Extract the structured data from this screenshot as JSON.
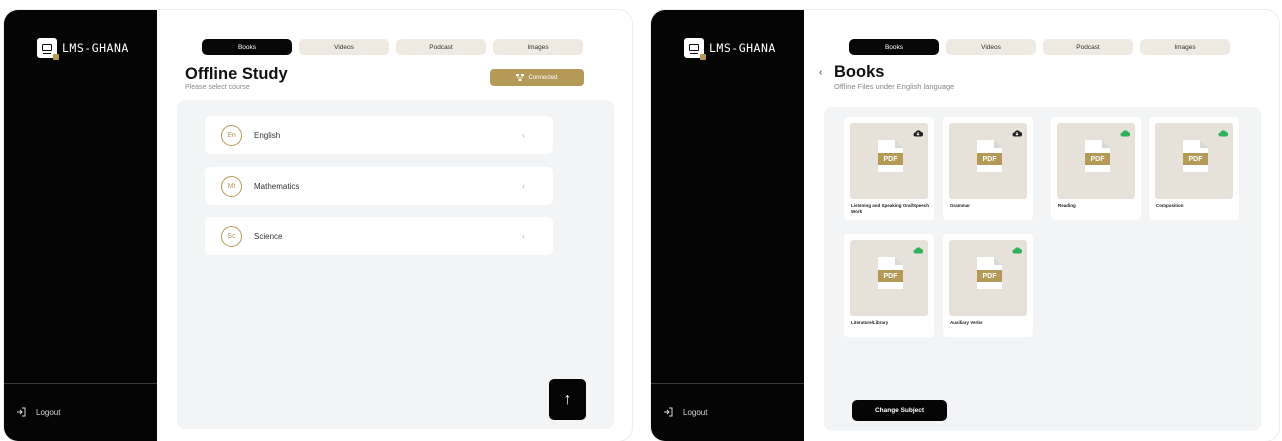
{
  "app": {
    "logo_text": "LMS-GHANA",
    "logout_label": "Logout"
  },
  "colors": {
    "accent": "#b59a57",
    "sidebar": "#050505",
    "tab_inactive": "#eeeae1",
    "panel": "#f3f4f5"
  },
  "tabs": [
    {
      "label": "Books",
      "active": true
    },
    {
      "label": "Videos",
      "active": false
    },
    {
      "label": "Podcast",
      "active": false
    },
    {
      "label": "Images",
      "active": false
    }
  ],
  "screen1": {
    "title": "Offline Study",
    "subtitle": "Please select course",
    "status_button": "Connected",
    "courses": [
      {
        "badge": "En",
        "name": "English"
      },
      {
        "badge": "Mt",
        "name": "Mathematics"
      },
      {
        "badge": "Sc",
        "name": "Science"
      }
    ],
    "scroll_top_icon": "arrow-up-icon"
  },
  "screen2": {
    "title": "Books",
    "subtitle": "Offline Files under English language",
    "pdf_tag": "PDF",
    "books": [
      {
        "label": "Listening and Speaking Oral/Speech Work",
        "cloud_icon": "cloud-download-icon",
        "downloaded": false
      },
      {
        "label": "Grammar",
        "cloud_icon": "cloud-download-icon",
        "downloaded": false
      },
      {
        "label": "Reading",
        "cloud_icon": "cloud-done-icon",
        "downloaded": true
      },
      {
        "label": "Composition",
        "cloud_icon": "cloud-done-icon",
        "downloaded": true
      },
      {
        "label": "Literature/Library",
        "cloud_icon": "cloud-done-icon",
        "downloaded": true
      },
      {
        "label": "Auxiliary Verbs",
        "cloud_icon": "cloud-done-icon",
        "downloaded": true
      }
    ],
    "change_subject_label": "Change Subject"
  }
}
